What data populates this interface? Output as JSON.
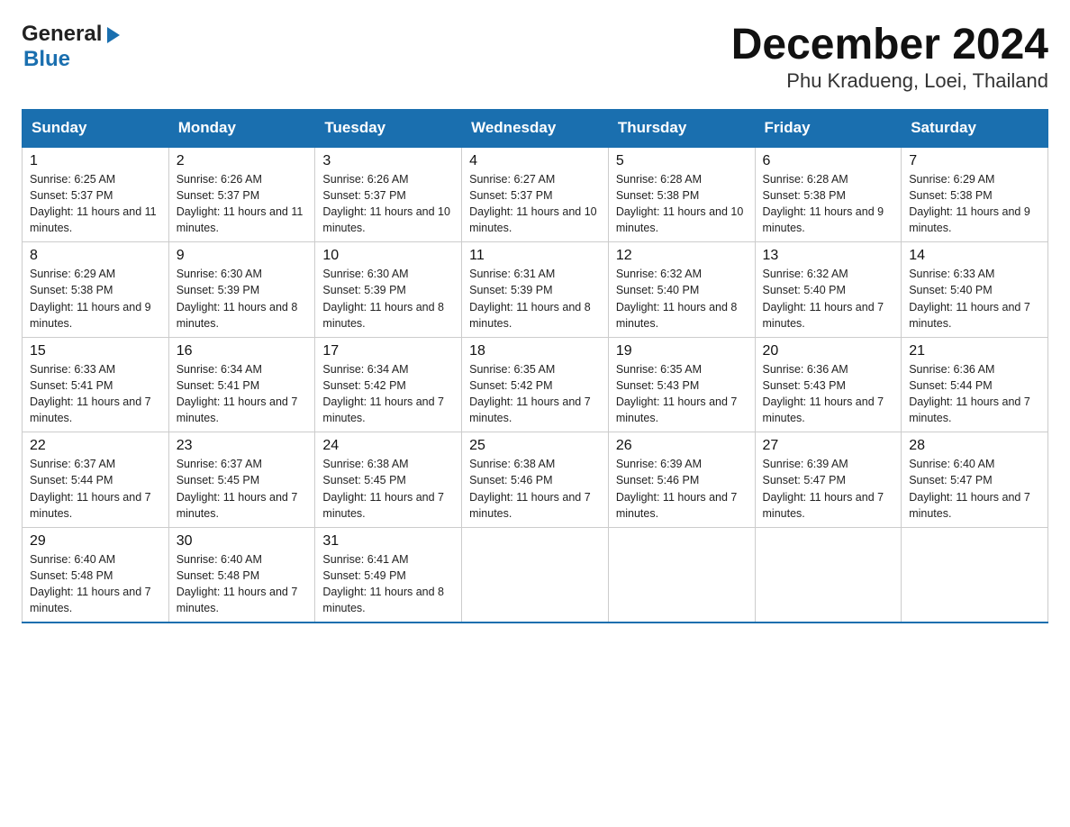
{
  "logo": {
    "line1": "General",
    "arrow": "▶",
    "line2": "Blue"
  },
  "title": "December 2024",
  "subtitle": "Phu Kradueng, Loei, Thailand",
  "days_of_week": [
    "Sunday",
    "Monday",
    "Tuesday",
    "Wednesday",
    "Thursday",
    "Friday",
    "Saturday"
  ],
  "weeks": [
    [
      {
        "day": 1,
        "sunrise": "6:25 AM",
        "sunset": "5:37 PM",
        "daylight": "11 hours and 11 minutes."
      },
      {
        "day": 2,
        "sunrise": "6:26 AM",
        "sunset": "5:37 PM",
        "daylight": "11 hours and 11 minutes."
      },
      {
        "day": 3,
        "sunrise": "6:26 AM",
        "sunset": "5:37 PM",
        "daylight": "11 hours and 10 minutes."
      },
      {
        "day": 4,
        "sunrise": "6:27 AM",
        "sunset": "5:37 PM",
        "daylight": "11 hours and 10 minutes."
      },
      {
        "day": 5,
        "sunrise": "6:28 AM",
        "sunset": "5:38 PM",
        "daylight": "11 hours and 10 minutes."
      },
      {
        "day": 6,
        "sunrise": "6:28 AM",
        "sunset": "5:38 PM",
        "daylight": "11 hours and 9 minutes."
      },
      {
        "day": 7,
        "sunrise": "6:29 AM",
        "sunset": "5:38 PM",
        "daylight": "11 hours and 9 minutes."
      }
    ],
    [
      {
        "day": 8,
        "sunrise": "6:29 AM",
        "sunset": "5:38 PM",
        "daylight": "11 hours and 9 minutes."
      },
      {
        "day": 9,
        "sunrise": "6:30 AM",
        "sunset": "5:39 PM",
        "daylight": "11 hours and 8 minutes."
      },
      {
        "day": 10,
        "sunrise": "6:30 AM",
        "sunset": "5:39 PM",
        "daylight": "11 hours and 8 minutes."
      },
      {
        "day": 11,
        "sunrise": "6:31 AM",
        "sunset": "5:39 PM",
        "daylight": "11 hours and 8 minutes."
      },
      {
        "day": 12,
        "sunrise": "6:32 AM",
        "sunset": "5:40 PM",
        "daylight": "11 hours and 8 minutes."
      },
      {
        "day": 13,
        "sunrise": "6:32 AM",
        "sunset": "5:40 PM",
        "daylight": "11 hours and 7 minutes."
      },
      {
        "day": 14,
        "sunrise": "6:33 AM",
        "sunset": "5:40 PM",
        "daylight": "11 hours and 7 minutes."
      }
    ],
    [
      {
        "day": 15,
        "sunrise": "6:33 AM",
        "sunset": "5:41 PM",
        "daylight": "11 hours and 7 minutes."
      },
      {
        "day": 16,
        "sunrise": "6:34 AM",
        "sunset": "5:41 PM",
        "daylight": "11 hours and 7 minutes."
      },
      {
        "day": 17,
        "sunrise": "6:34 AM",
        "sunset": "5:42 PM",
        "daylight": "11 hours and 7 minutes."
      },
      {
        "day": 18,
        "sunrise": "6:35 AM",
        "sunset": "5:42 PM",
        "daylight": "11 hours and 7 minutes."
      },
      {
        "day": 19,
        "sunrise": "6:35 AM",
        "sunset": "5:43 PM",
        "daylight": "11 hours and 7 minutes."
      },
      {
        "day": 20,
        "sunrise": "6:36 AM",
        "sunset": "5:43 PM",
        "daylight": "11 hours and 7 minutes."
      },
      {
        "day": 21,
        "sunrise": "6:36 AM",
        "sunset": "5:44 PM",
        "daylight": "11 hours and 7 minutes."
      }
    ],
    [
      {
        "day": 22,
        "sunrise": "6:37 AM",
        "sunset": "5:44 PM",
        "daylight": "11 hours and 7 minutes."
      },
      {
        "day": 23,
        "sunrise": "6:37 AM",
        "sunset": "5:45 PM",
        "daylight": "11 hours and 7 minutes."
      },
      {
        "day": 24,
        "sunrise": "6:38 AM",
        "sunset": "5:45 PM",
        "daylight": "11 hours and 7 minutes."
      },
      {
        "day": 25,
        "sunrise": "6:38 AM",
        "sunset": "5:46 PM",
        "daylight": "11 hours and 7 minutes."
      },
      {
        "day": 26,
        "sunrise": "6:39 AM",
        "sunset": "5:46 PM",
        "daylight": "11 hours and 7 minutes."
      },
      {
        "day": 27,
        "sunrise": "6:39 AM",
        "sunset": "5:47 PM",
        "daylight": "11 hours and 7 minutes."
      },
      {
        "day": 28,
        "sunrise": "6:40 AM",
        "sunset": "5:47 PM",
        "daylight": "11 hours and 7 minutes."
      }
    ],
    [
      {
        "day": 29,
        "sunrise": "6:40 AM",
        "sunset": "5:48 PM",
        "daylight": "11 hours and 7 minutes."
      },
      {
        "day": 30,
        "sunrise": "6:40 AM",
        "sunset": "5:48 PM",
        "daylight": "11 hours and 7 minutes."
      },
      {
        "day": 31,
        "sunrise": "6:41 AM",
        "sunset": "5:49 PM",
        "daylight": "11 hours and 8 minutes."
      },
      null,
      null,
      null,
      null
    ]
  ]
}
